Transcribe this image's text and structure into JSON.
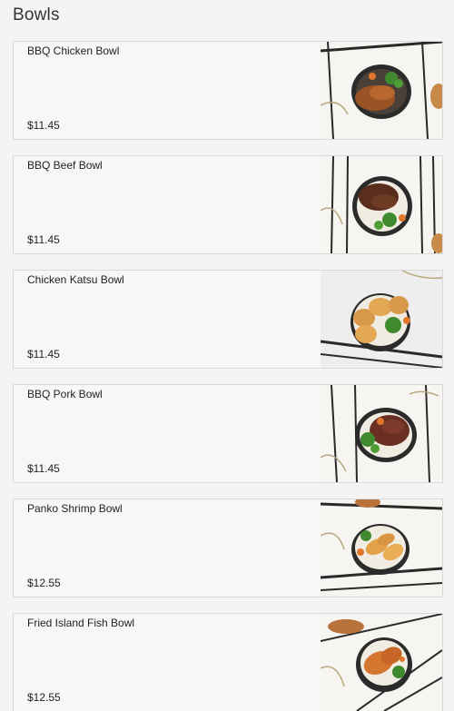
{
  "section": {
    "title": "Bowls"
  },
  "items": [
    {
      "name": "BBQ Chicken Bowl",
      "price": "$11.45",
      "photo": "bbq-chicken-bowl-photo"
    },
    {
      "name": "BBQ Beef Bowl",
      "price": "$11.45",
      "photo": "bbq-beef-bowl-photo"
    },
    {
      "name": "Chicken Katsu Bowl",
      "price": "$11.45",
      "photo": "chicken-katsu-bowl-photo"
    },
    {
      "name": "BBQ Pork Bowl",
      "price": "$11.45",
      "photo": "bbq-pork-bowl-photo"
    },
    {
      "name": "Panko Shrimp Bowl",
      "price": "$12.55",
      "photo": "panko-shrimp-bowl-photo"
    },
    {
      "name": "Fried Island Fish Bowl",
      "price": "$12.55",
      "photo": "fried-island-fish-bowl-photo"
    }
  ]
}
